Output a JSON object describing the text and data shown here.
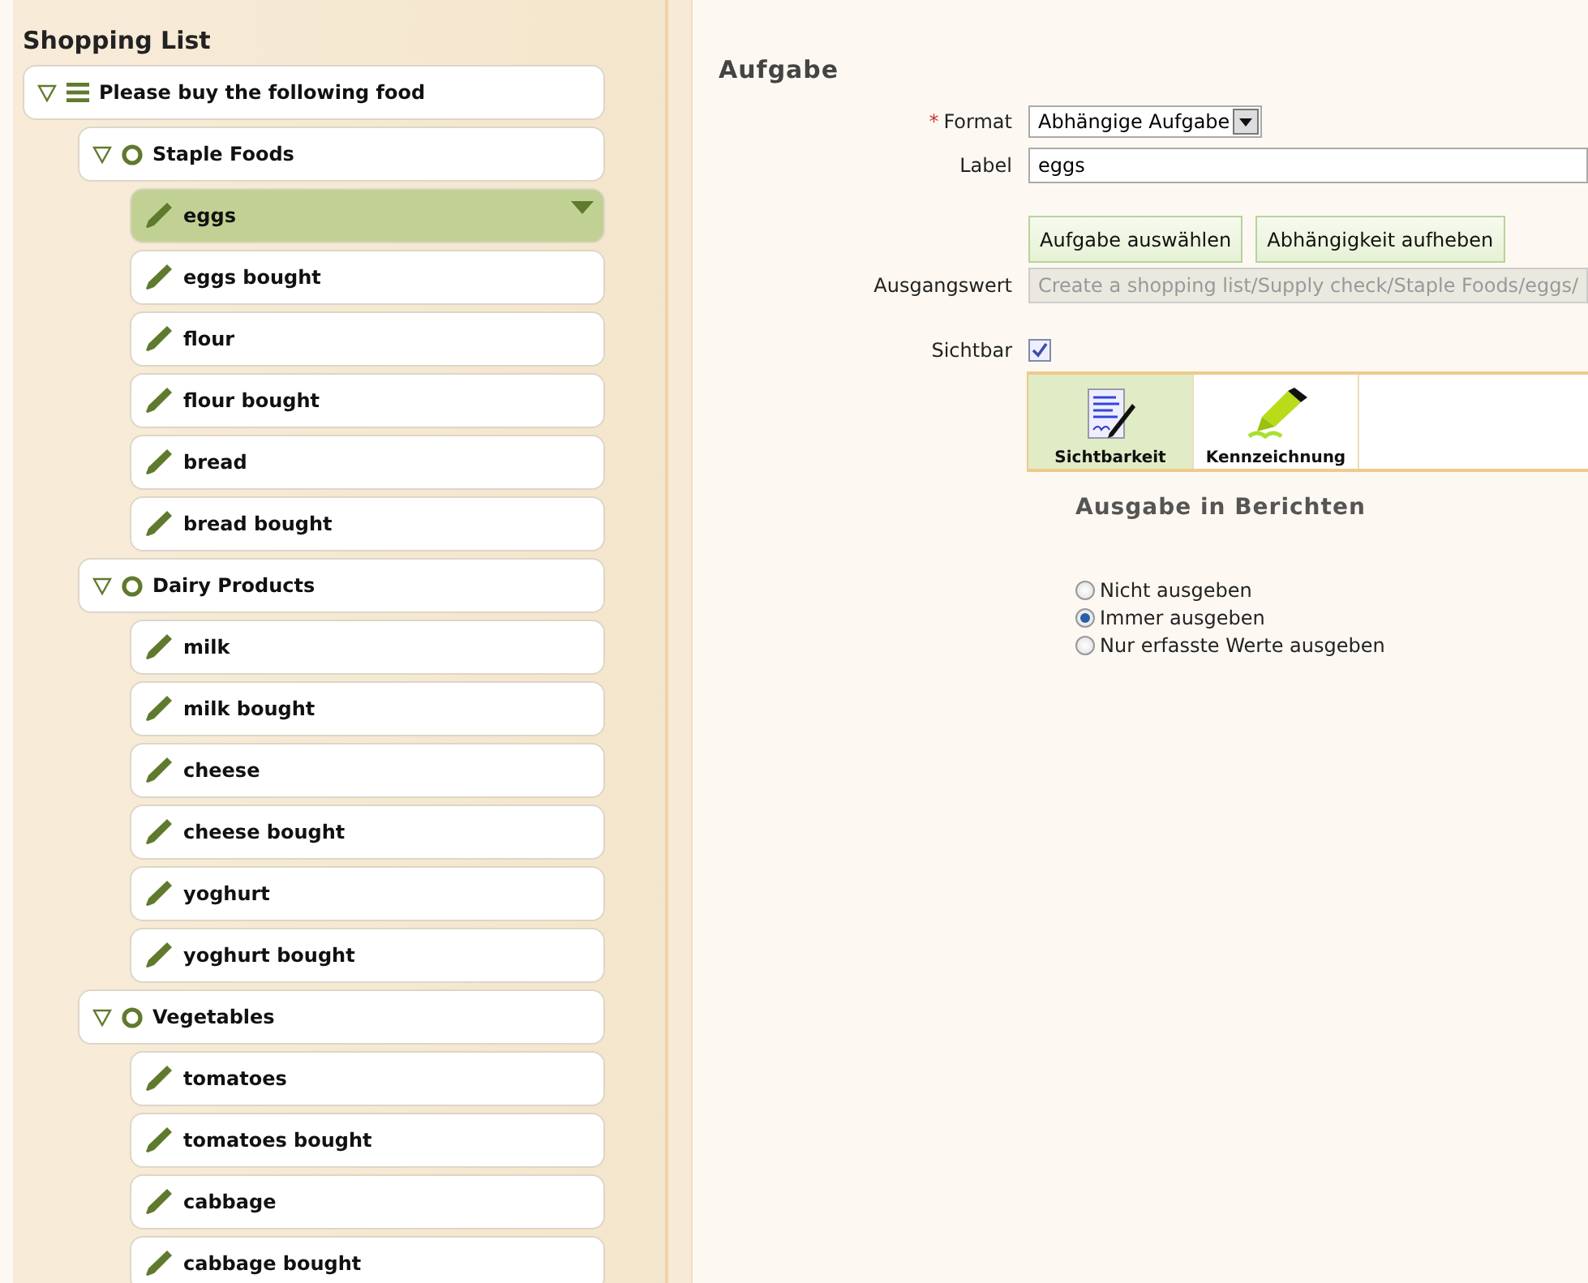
{
  "sidebar": {
    "title": "Shopping List",
    "tree": [
      {
        "kind": "list",
        "label": "Please buy the following food",
        "expanded": true,
        "selected": false,
        "children": [
          {
            "kind": "group",
            "label": "Staple Foods",
            "expanded": true,
            "selected": false,
            "children": [
              {
                "kind": "task",
                "label": "eggs",
                "selected": true
              },
              {
                "kind": "task",
                "label": "eggs bought",
                "selected": false
              },
              {
                "kind": "task",
                "label": "flour",
                "selected": false
              },
              {
                "kind": "task",
                "label": "flour bought",
                "selected": false
              },
              {
                "kind": "task",
                "label": "bread",
                "selected": false
              },
              {
                "kind": "task",
                "label": "bread bought",
                "selected": false
              }
            ]
          },
          {
            "kind": "group",
            "label": "Dairy Products",
            "expanded": true,
            "selected": false,
            "children": [
              {
                "kind": "task",
                "label": "milk",
                "selected": false
              },
              {
                "kind": "task",
                "label": "milk bought",
                "selected": false
              },
              {
                "kind": "task",
                "label": "cheese",
                "selected": false
              },
              {
                "kind": "task",
                "label": "cheese bought",
                "selected": false
              },
              {
                "kind": "task",
                "label": "yoghurt",
                "selected": false
              },
              {
                "kind": "task",
                "label": "yoghurt bought",
                "selected": false
              }
            ]
          },
          {
            "kind": "group",
            "label": "Vegetables",
            "expanded": true,
            "selected": false,
            "children": [
              {
                "kind": "task",
                "label": "tomatoes",
                "selected": false
              },
              {
                "kind": "task",
                "label": "tomatoes bought",
                "selected": false
              },
              {
                "kind": "task",
                "label": "cabbage",
                "selected": false
              },
              {
                "kind": "task",
                "label": "cabbage bought",
                "selected": false
              }
            ]
          }
        ]
      }
    ]
  },
  "form": {
    "title": "Aufgabe",
    "required_mark": "*",
    "format": {
      "label": "Format",
      "value": "Abhängige Aufgabe"
    },
    "label_field": {
      "label": "Label",
      "value": "eggs"
    },
    "buttons": [
      "Aufgabe auswählen",
      "Abhängigkeit aufheben"
    ],
    "initial_value": {
      "label": "Ausgangswert",
      "value": "Create a shopping list/Supply check/Staple Foods/eggs/",
      "disabled": true
    },
    "visible": {
      "label": "Sichtbar",
      "checked": true
    },
    "tabs": [
      {
        "label": "Sichtbarkeit",
        "kind": "document",
        "selected": true
      },
      {
        "label": "Kennzeichnung",
        "kind": "marker",
        "selected": false
      }
    ],
    "section_title": "Ausgabe in Berichten",
    "radios": [
      {
        "label": "Nicht ausgeben",
        "selected": false
      },
      {
        "label": "Immer ausgeben",
        "selected": true
      },
      {
        "label": "Nur erfasste Werte ausgeben",
        "selected": false
      }
    ]
  }
}
